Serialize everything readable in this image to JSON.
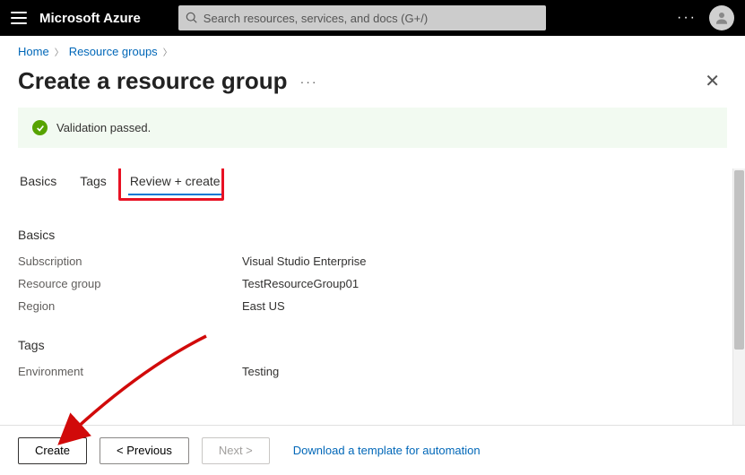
{
  "header": {
    "brand": "Microsoft Azure",
    "search_placeholder": "Search resources, services, and docs (G+/)"
  },
  "breadcrumb": {
    "items": [
      {
        "label": "Home"
      },
      {
        "label": "Resource groups"
      }
    ]
  },
  "page": {
    "title": "Create a resource group"
  },
  "validation": {
    "message": "Validation passed."
  },
  "tabs": [
    {
      "label": "Basics"
    },
    {
      "label": "Tags"
    },
    {
      "label": "Review + create"
    }
  ],
  "sections": {
    "basics": {
      "title": "Basics",
      "rows": [
        {
          "label": "Subscription",
          "value": "Visual Studio Enterprise"
        },
        {
          "label": "Resource group",
          "value": "TestResourceGroup01"
        },
        {
          "label": "Region",
          "value": "East US"
        }
      ]
    },
    "tags": {
      "title": "Tags",
      "rows": [
        {
          "label": "Environment",
          "value": "Testing"
        }
      ]
    }
  },
  "footer": {
    "create": "Create",
    "previous": "< Previous",
    "next": "Next >",
    "download": "Download a template for automation"
  }
}
